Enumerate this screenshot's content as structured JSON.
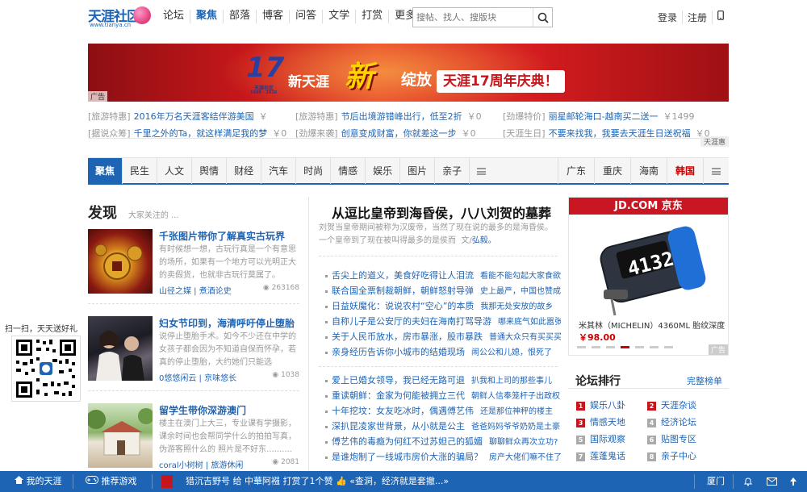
{
  "header": {
    "logo_text": "天涯社区",
    "logo_url": "www.tianya.cn",
    "nav": [
      {
        "label": "论坛",
        "active": false
      },
      {
        "label": "聚焦",
        "active": true
      },
      {
        "label": "部落",
        "active": false
      },
      {
        "label": "博客",
        "active": false
      },
      {
        "label": "问答",
        "active": false
      },
      {
        "label": "文学",
        "active": false
      },
      {
        "label": "打赏",
        "active": false
      },
      {
        "label": "更多",
        "active": false
      }
    ],
    "search_placeholder": "搜帖、找人、搜版块",
    "login": "登录",
    "register": "注册"
  },
  "banner": {
    "num": "17",
    "badge_text": "天涯社区",
    "badge_years": "1999 · 2016",
    "t1": "新天涯",
    "t2": "新",
    "t3": "绽放",
    "t4": "天涯17周年庆典！",
    "ad": "广告"
  },
  "promo": {
    "row1": [
      {
        "cat": "[旅游特惠]",
        "text": "2016年万名天涯客结伴游美国",
        "price": "￥"
      },
      {
        "cat": "[旅游特惠]",
        "text": "节后出境游错峰出行，低至2折",
        "price": "￥0"
      },
      {
        "cat": "[劲爆特价]",
        "text": "丽星邮轮海口-越南买二送一",
        "price": "￥1499"
      }
    ],
    "row2": [
      {
        "cat": "[据说众筹]",
        "text": "千里之外的Ta，就这样满足我的梦",
        "price": "￥0"
      },
      {
        "cat": "[劲爆来袭]",
        "text": "创意变成财富，你就差这一步",
        "price": "￥0"
      },
      {
        "cat": "[天涯生日]",
        "text": "不要来找我，我要去天涯生日送祝福",
        "price": "￥0"
      }
    ],
    "tag": "天涯惠"
  },
  "channels": {
    "left": [
      "聚焦",
      "民生",
      "人文",
      "舆情",
      "财经",
      "汽车",
      "时尚",
      "情感",
      "娱乐",
      "图片",
      "亲子"
    ],
    "right": [
      "广东",
      "重庆",
      "海南",
      "韩国"
    ]
  },
  "faxian": {
    "title": "发现",
    "sub": "大家关注的 ...",
    "stories": [
      {
        "title": "千张图片带你了解真实古玩界",
        "desc": "有时候想一想，古玩行真是一个有意思的场所，如果有一个地方可以光明正大的卖假货，也就非古玩行莫属了。",
        "author": "山径之媒",
        "tag": "煮酒论史",
        "count": "263168"
      },
      {
        "title": "妇女节印到，海清呼吁停止堕胎",
        "desc": "说停止堕胎手术。如今不少还在中学的女孩子都会因为不知道自保而怀孕，若真的停止堕胎，大约她们只能选择.........",
        "author": "0悠悠闲云",
        "tag": "京味悠长",
        "count": "1038"
      },
      {
        "title": "留学生带你深游澳门",
        "desc": "楼主在澳门上大三，专业课有学摄影，课余时间也会帮同学什么的拍拍写真，伪游客照什么的 照片是不好东..........",
        "author": "coral小树树",
        "tag": "旅游休闲",
        "count": "2081"
      }
    ]
  },
  "headline": {
    "title": "从逗比皇帝到海昏侯，八八刘贺的墓葬",
    "summary": "刘贺当皇帝期间被称为汉废帝，当然了现在说的最多的是海昏侯。一个皇帝到了现在被叫得最多的是侯而",
    "author_prefix": "文/",
    "author": "弘毅。"
  },
  "news": [
    {
      "t": "舌尖上的道义，美食好吃得让人泪流",
      "s": "看能不能勾起大家食欲"
    },
    {
      "t": "联合国全票制裁朝鲜，朝鲜怒射导弹",
      "s": "史上最严，中国也赞成"
    },
    {
      "t": "日益妖魔化：说说农村“空心”的本质",
      "s": "我那无处安放的故乡"
    },
    {
      "t": "自称儿子是公安厅的夫妇在海南打骂导游",
      "s": "哪来底气如此嚣张"
    },
    {
      "t": "关于人民币放水，房市暴涨，股市暴跌",
      "s": "普通大众只有买买买"
    },
    {
      "t": "亲身经历告诉你小城市的结婚现场",
      "s": "闹公公和儿媳，恨死了"
    },
    {
      "t": "爱上已婚女领导，我已经无路可退",
      "s": "扒我和上司的那些事儿"
    },
    {
      "t": "重读朝鲜：金家为何能被拥立三代",
      "s": "朝鲜人信奉笼杆子出政权"
    },
    {
      "t": "十年挖坟：女友吃冰时，偶遇傅艺伟",
      "s": "还是那位神秤的楼主"
    },
    {
      "t": "深扒昆凌家世背景，从小就是公主",
      "s": "爸爸妈妈爷爷奶奶是土豪"
    },
    {
      "t": "傅艺伟的毒瘾为何红不过苏妲己的狐媚",
      "s": "聊聊鲜众再次立功?"
    },
    {
      "t": "是谁炮制了一线城市房价大涨的骗局？",
      "s": "房产大佬们嘛不住了"
    }
  ],
  "jd": {
    "title": "JD.COM 京东",
    "product": "米其林（MICHELIN）4360ML 胎纹深度",
    "price": "￥98.00",
    "display": "4132",
    "ad": "广告"
  },
  "rank": {
    "title": "论坛排行",
    "more": "完整榜单",
    "items": [
      {
        "n": "1",
        "label": "娱乐八卦"
      },
      {
        "n": "2",
        "label": "天涯杂谈"
      },
      {
        "n": "3",
        "label": "情感天地"
      },
      {
        "n": "4",
        "label": "经济论坛"
      },
      {
        "n": "5",
        "label": "国际观察"
      },
      {
        "n": "6",
        "label": "贴图专区"
      },
      {
        "n": "7",
        "label": "莲蓬鬼话"
      },
      {
        "n": "8",
        "label": "亲子中心"
      }
    ]
  },
  "qr": {
    "label": "扫一扫，天天送好礼"
  },
  "bottom": {
    "my_tianya": "我的天涯",
    "games": "推荐游戏",
    "ticker": "猎沉吉野号 给 中華阿襁 打赏了1个赞",
    "ticker2": "«查洞，经济就是套撤...»",
    "xiamen": "厦门"
  }
}
